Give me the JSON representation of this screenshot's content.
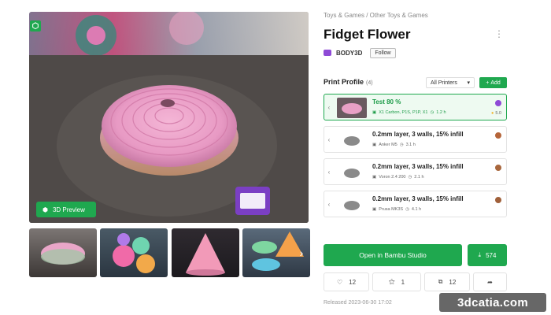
{
  "gallery": {
    "preview_label": "3D Preview"
  },
  "header": {
    "breadcrumb": "Toys & Games / Other Toys & Games",
    "title": "Fidget Flower",
    "author": "BODY3D",
    "follow_label": "Follow"
  },
  "print_profile": {
    "title": "Print Profile",
    "count": "(4)",
    "printer_filter": "All Printers",
    "add_label": "Add",
    "profiles": [
      {
        "title": "Test 80 %",
        "meta": "X1 Carbon, P1S, P1P, X1",
        "time": "1.2 h",
        "rating": "5.0",
        "selected": true
      },
      {
        "title": "0.2mm layer, 3 walls, 15% infill",
        "meta": "Anker M5",
        "time": "3.1 h",
        "rating": "",
        "selected": false
      },
      {
        "title": "0.2mm layer, 3 walls, 15% infill",
        "meta": "Voron 2.4 200",
        "time": "2.1 h",
        "rating": "",
        "selected": false
      },
      {
        "title": "0.2mm layer, 3 walls, 15% infill",
        "meta": "Prusa MK3S",
        "time": "4.1 h",
        "rating": "",
        "selected": false
      }
    ]
  },
  "actions": {
    "open_label": "Open in Bambu Studio",
    "download_count": "574",
    "likes": "12",
    "boosts": "1",
    "collects": "12"
  },
  "released": "Released 2023-06-30 17:02",
  "watermark": "3dcatia.com",
  "colors": {
    "accent": "#1fa84f"
  }
}
